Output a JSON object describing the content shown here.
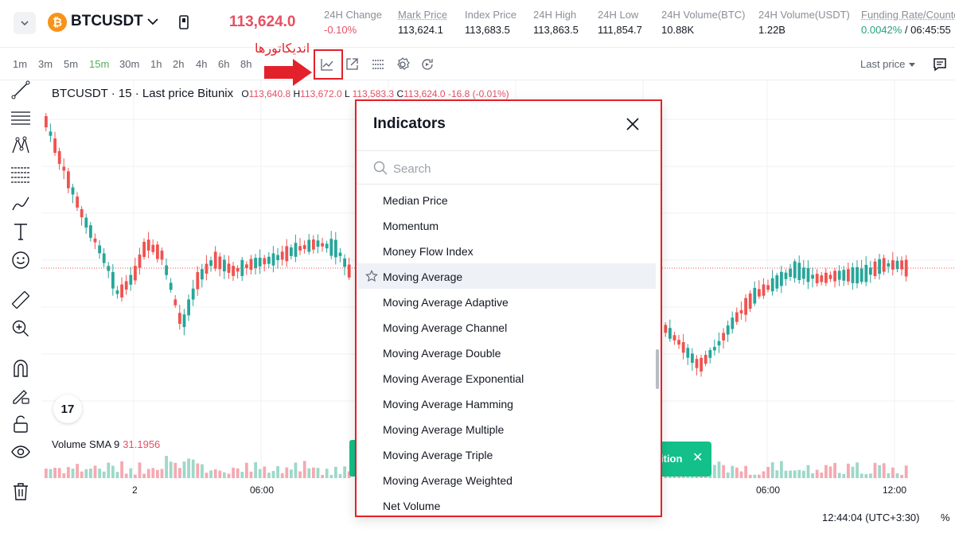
{
  "header": {
    "symbol": "BTCUSDT",
    "coin_glyph": "₿",
    "last_price": "113,624.0",
    "stats": [
      {
        "label": "24H Change",
        "value": "-0.10%"
      },
      {
        "label": "Mark Price",
        "value": "113,624.1"
      },
      {
        "label": "Index Price",
        "value": "113,683.5"
      },
      {
        "label": "24H High",
        "value": "113,863.5"
      },
      {
        "label": "24H Low",
        "value": "111,854.7"
      },
      {
        "label": "24H Volume(BTC)",
        "value": "10.88K"
      },
      {
        "label": "24H Volume(USDT)",
        "value": "1.22B"
      }
    ],
    "funding": {
      "label": "Funding Rate/Countd",
      "rate": "0.0042%",
      "countdown": "/ 06:45:55"
    }
  },
  "toolbar": {
    "timeframes": [
      "1m",
      "3m",
      "5m",
      "15m",
      "30m",
      "1h",
      "2h",
      "4h",
      "6h",
      "8h"
    ],
    "active_timeframe": "15m",
    "price_type": "Last price"
  },
  "annotation": {
    "label": "اندیکاتورها"
  },
  "chart": {
    "legend_title": "BTCUSDT · 15 · Last price Bitunix",
    "ohlc": {
      "o_label": "O",
      "o": "113,640.8",
      "h_label": "H",
      "h": "113,672.0",
      "l_label": "L",
      "l": "113,583.3",
      "c_label": "C",
      "c": "113,624.0",
      "change": "-16.8 (-0.01%)"
    },
    "volume_label": "Volume SMA 9",
    "volume_value": "31.1956",
    "x_ticks": [
      "2",
      "06:00",
      "06:00",
      "12:00"
    ],
    "toast_text": "ition",
    "time_readout": "12:44:04 (UTC+3:30)",
    "pct_label": "%",
    "tv_logo": "17"
  },
  "indicators_dialog": {
    "title": "Indicators",
    "search_placeholder": "Search",
    "items": [
      "Median Price",
      "Momentum",
      "Money Flow Index",
      "Moving Average",
      "Moving Average Adaptive",
      "Moving Average Channel",
      "Moving Average Double",
      "Moving Average Exponential",
      "Moving Average Hamming",
      "Moving Average Multiple",
      "Moving Average Triple",
      "Moving Average Weighted",
      "Net Volume"
    ],
    "highlighted_item": "Moving Average"
  },
  "colors": {
    "up": "#26a69a",
    "down": "#ef5350",
    "accent": "#52b05b",
    "annotation": "#e3212a"
  }
}
